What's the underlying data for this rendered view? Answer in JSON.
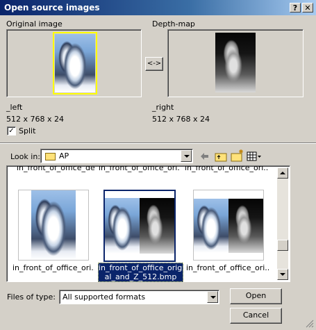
{
  "window": {
    "title": "Open source images"
  },
  "titlebar": {
    "help_label": "?",
    "close_label": "✕"
  },
  "left_panel": {
    "header": "Original image",
    "name": "_left",
    "info": "512 x 768 x 24"
  },
  "right_panel": {
    "header": "Depth-map",
    "name": "_right",
    "info": "512 x 768 x 24"
  },
  "swap_button": {
    "label": "<->"
  },
  "split": {
    "label": "Split",
    "checked": true,
    "mark": "✓"
  },
  "lookin": {
    "label": "Look in:",
    "folder": "AP",
    "icons": [
      "back-arrow-icon",
      "up-folder-icon",
      "new-folder-icon",
      "view-menu-icon"
    ]
  },
  "file_list": {
    "top_row_names": [
      "in_front_of_office_de...",
      "in_front_of_office_ori...",
      "in_front_of_office_ori..."
    ],
    "items": [
      {
        "name": "in_front_of_office_ori...",
        "selected": false
      },
      {
        "name_line1": "in_front_of_office_origin",
        "name_line2": "al_and_Z_512.bmp",
        "selected": true
      },
      {
        "name": "in_front_of_office_ori...",
        "selected": false
      }
    ]
  },
  "filetype": {
    "label": "Files of type:",
    "value": "All supported formats"
  },
  "buttons": {
    "open": "Open",
    "cancel": "Cancel"
  },
  "colors": {
    "title_start": "#0a246a",
    "title_end": "#a6caf0",
    "selection": "#0a246a",
    "preview_highlight": "#ffff00"
  }
}
